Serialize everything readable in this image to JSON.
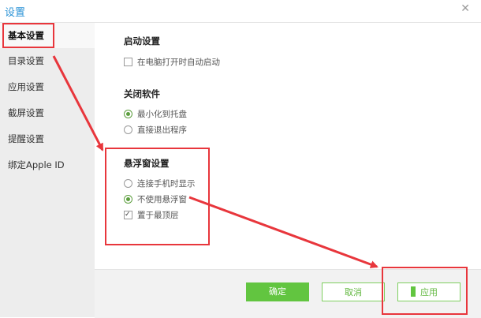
{
  "window": {
    "title": "设置",
    "close_glyph": "✕"
  },
  "sidebar": {
    "items": [
      {
        "label": "基本设置",
        "active": true
      },
      {
        "label": "目录设置"
      },
      {
        "label": "应用设置"
      },
      {
        "label": "截屏设置"
      },
      {
        "label": "提醒设置"
      },
      {
        "label": "绑定Apple ID"
      }
    ]
  },
  "main": {
    "startup": {
      "title": "启动设置",
      "options": [
        {
          "label": "在电脑打开时自动启动",
          "checked": false
        }
      ]
    },
    "close_software": {
      "title": "关闭软件",
      "options": [
        {
          "label": "最小化到托盘",
          "selected": true
        },
        {
          "label": "直接退出程序",
          "selected": false
        }
      ]
    },
    "float_window": {
      "title": "悬浮窗设置",
      "options": [
        {
          "label": "连接手机时显示",
          "selected": false
        },
        {
          "label": "不使用悬浮窗",
          "selected": true
        }
      ],
      "checkbox": {
        "label": "置于最顶层",
        "checked": true
      }
    }
  },
  "footer": {
    "ok_label": "确定",
    "cancel_label": "取消",
    "apply_label": "应用"
  },
  "annotation": {
    "color": "#e8363c"
  },
  "colors": {
    "accent": "#2b93d6",
    "green": "#62c540",
    "highlight": "#e8363c"
  }
}
